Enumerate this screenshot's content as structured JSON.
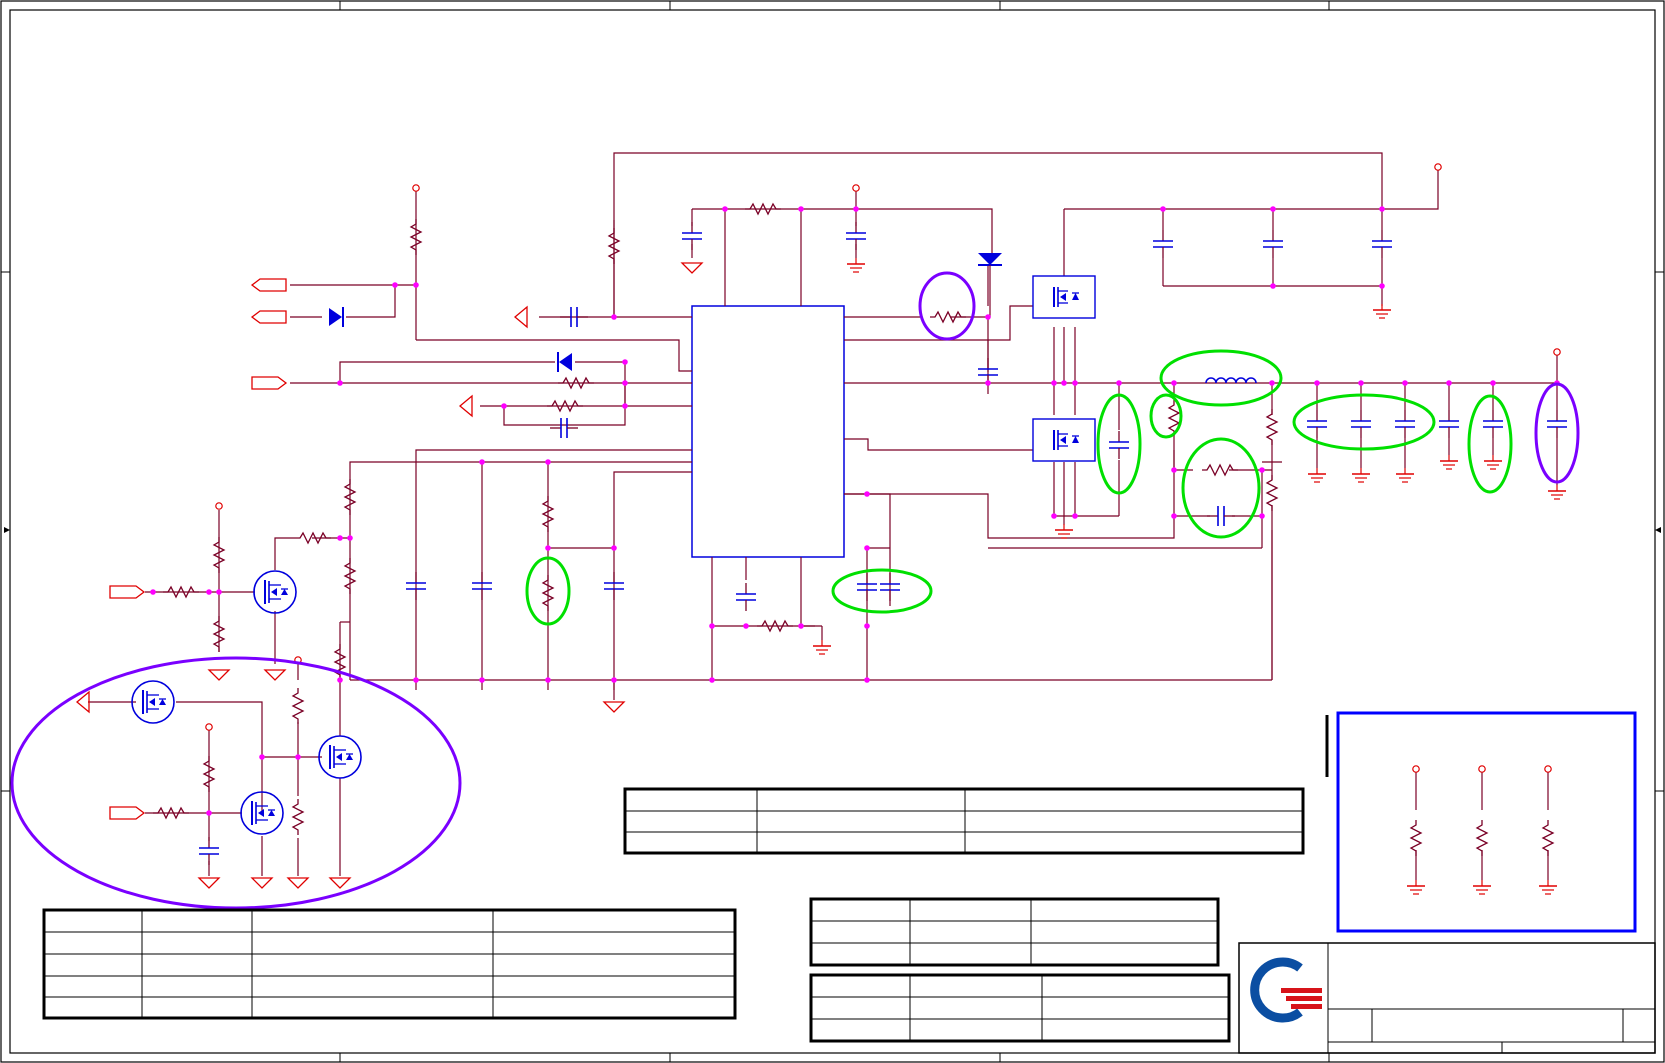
{
  "sheet": {
    "colors": {
      "background": "#ffffff",
      "frame": "#000000",
      "wire": "#7a0026",
      "pin": "#e00000",
      "junction": "#ff00ff",
      "component": "#0000dd",
      "highlight_green": "#00e000",
      "highlight_purple": "#7a00ff",
      "notes_box": "#0000ff",
      "logo_blue": "#0b4ea2",
      "logo_red": "#d7141a"
    },
    "icons": {
      "logo": "company-logo-icon",
      "mosfet": "mosfet-icon",
      "diode": "diode-icon",
      "resistor": "resistor-icon",
      "capacitor": "capacitor-icon",
      "inductor": "inductor-icon",
      "ground": "ground-icon",
      "offpage_connector": "offpage-connector-icon",
      "power_pin": "power-pin-icon"
    },
    "tables": {
      "left": {
        "rows": 5,
        "cols": 4
      },
      "middle": {
        "rows": 3,
        "cols": 3
      },
      "bottom_center_upper": {
        "rows": 3,
        "cols": 3
      },
      "bottom_center_lower": {
        "rows": 3,
        "cols": 3
      }
    },
    "highlights": {
      "green_count": 8,
      "purple_count": 3
    }
  }
}
